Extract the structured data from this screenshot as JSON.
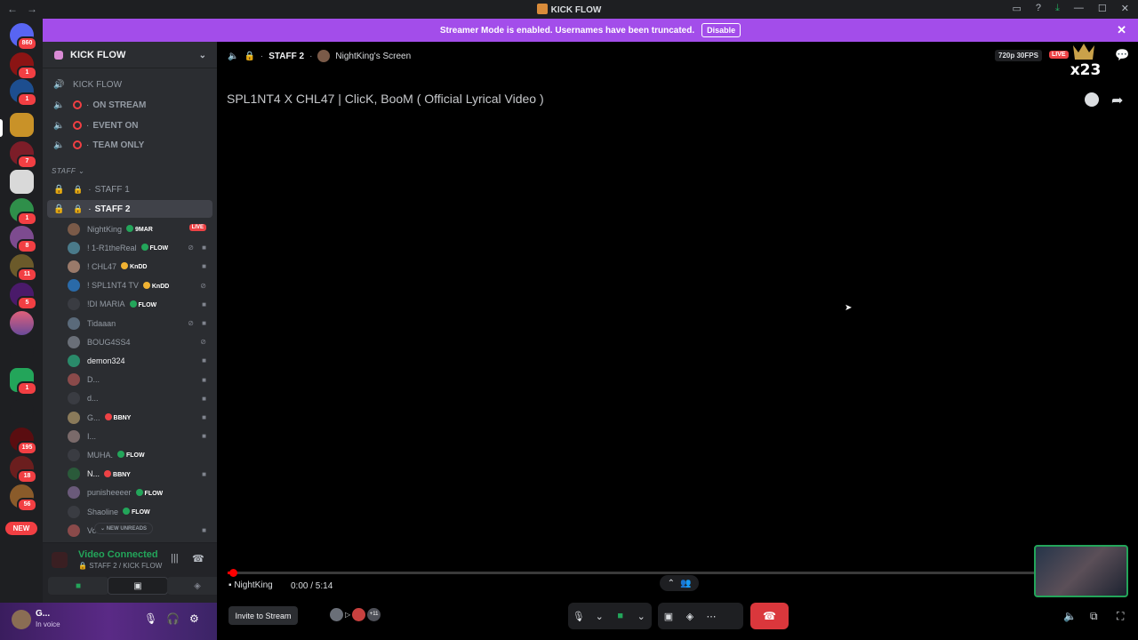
{
  "app": {
    "title": "KICK FLOW"
  },
  "banner": {
    "text": "Streamer Mode is enabled. Usernames have been truncated.",
    "disable_label": "Disable"
  },
  "rail": {
    "badges": [
      "860",
      "1",
      "1",
      "7",
      "1",
      "8",
      "11",
      "5",
      "1",
      "195",
      "18",
      "56"
    ],
    "new_label": "NEW"
  },
  "guild": {
    "name": "KICK FLOW"
  },
  "channels": {
    "kickflow": "KICK FLOW",
    "on_stream": "ON STREAM",
    "event_on": "EVENT ON",
    "team_only": "TEAM ONLY",
    "category": "STAFF",
    "staff1": "STAFF 1",
    "staff2": "STAFF 2"
  },
  "users": [
    {
      "name": "NightKing",
      "tag": "9MAR",
      "live": "LIVE",
      "color": "#23a55a"
    },
    {
      "name": "! 1-R1theReal",
      "tag": "FLOW",
      "color": "#23a55a"
    },
    {
      "name": "! CHL47",
      "tag": "KnDD",
      "color": "#f0b232"
    },
    {
      "name": "! SPL1NT4 TV",
      "tag": "KnDD",
      "color": "#f0b232"
    },
    {
      "name": "!DI MARIA",
      "tag": "FLOW",
      "color": "#23a55a"
    },
    {
      "name": "Tidaaan",
      "tag": "",
      "color": ""
    },
    {
      "name": "BOUG4SS4",
      "tag": "",
      "color": ""
    },
    {
      "name": "demon324",
      "tag": "",
      "color": ""
    },
    {
      "name": "D...",
      "tag": "",
      "color": ""
    },
    {
      "name": "d...",
      "tag": "",
      "color": ""
    },
    {
      "name": "G...",
      "tag": "BBNY",
      "color": "#ed4245"
    },
    {
      "name": "I...",
      "tag": "",
      "color": ""
    },
    {
      "name": "MUHA.",
      "tag": "FLOW",
      "color": "#23a55a"
    },
    {
      "name": "N...",
      "tag": "BBNY",
      "color": "#ed4245"
    },
    {
      "name": "punisheeeer",
      "tag": "FLOW",
      "color": "#23a55a"
    },
    {
      "name": "Shaoline",
      "tag": "FLOW",
      "color": "#23a55a"
    },
    {
      "name": "Vo...",
      "tag": "BBNY",
      "color": "#ed4245"
    }
  ],
  "new_unreads": "NEW UNREADS",
  "voice": {
    "status": "Video Connected",
    "location": "STAFF 2 / KICK FLOW"
  },
  "user_panel": {
    "name": "G...",
    "status": "In voice"
  },
  "stream": {
    "channel": "STAFF 2",
    "screen": "NightKing's Screen",
    "quality": "720p 30FPS",
    "live": "LIVE",
    "crown_count": "x23",
    "video_title": "SPL1NT4 X CHL47 | ClicK, BooM ( Official Lyrical Video )",
    "player_name": "NightKing",
    "time": "0:00 / 5:14",
    "progress": 0.005
  },
  "controls": {
    "invite": "Invite to Stream",
    "viewer_count": "+11"
  }
}
